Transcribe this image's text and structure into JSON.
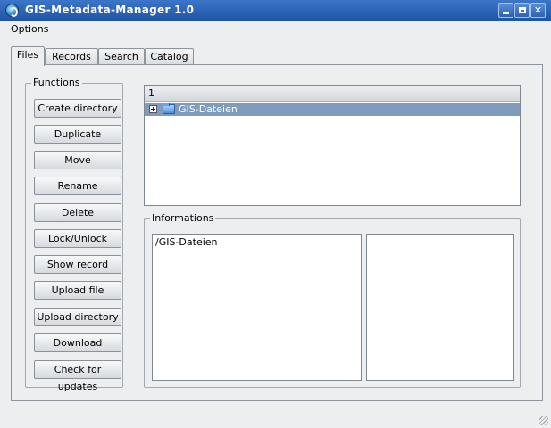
{
  "window": {
    "title": "GIS-Metadata-Manager 1.0"
  },
  "menu": {
    "options": "Options"
  },
  "tabs": [
    "Files",
    "Records",
    "Search",
    "Catalog"
  ],
  "functions": {
    "title": "Functions",
    "buttons": [
      "Create directory",
      "Duplicate",
      "Move",
      "Rename",
      "Delete",
      "Lock/Unlock",
      "Show record",
      "Upload file",
      "Upload directory",
      "Download",
      "Check for updates"
    ]
  },
  "tree": {
    "column_header": "1",
    "items": [
      {
        "label": "GIS-Dateien",
        "selected": true
      }
    ]
  },
  "informations": {
    "title": "Informations",
    "path": "/GIS-Dateien",
    "details": ""
  },
  "colors": {
    "titlebar": "#2a62b6",
    "selection": "#7f9bbd"
  }
}
